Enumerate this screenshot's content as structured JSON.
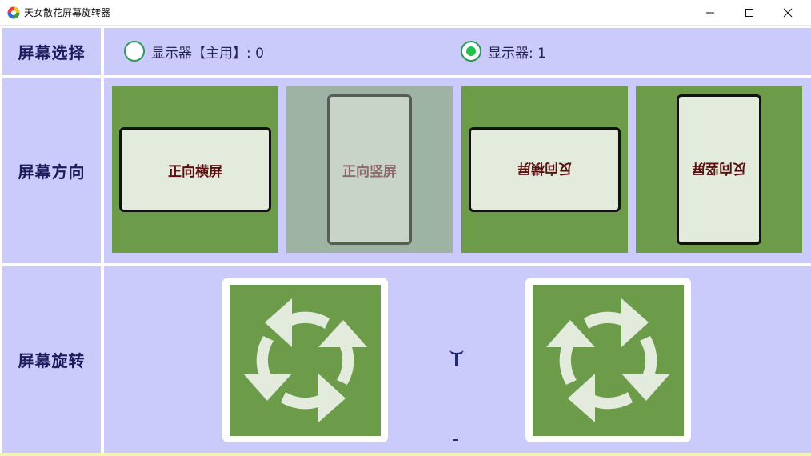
{
  "window": {
    "title": "天女散花屏幕旋转器",
    "icon": "app-logo-icon",
    "controls": [
      "minimize-icon",
      "maximize-icon",
      "close-icon"
    ]
  },
  "rows": {
    "screen_select": {
      "label": "屏幕选择",
      "options": [
        {
          "label": "显示器【主用】: 0",
          "selected": false
        },
        {
          "label": "显示器: 1",
          "selected": true
        }
      ]
    },
    "orientation": {
      "label": "屏幕方向",
      "tiles": [
        {
          "label": "正向横屏",
          "state": "enabled"
        },
        {
          "label": "正向竖屏",
          "state": "disabled"
        },
        {
          "label": "反向横屏",
          "state": "enabled"
        },
        {
          "label": "反向竖屏",
          "state": "enabled"
        }
      ]
    },
    "rotation": {
      "label": "屏幕旋转",
      "buttons": [
        "rotate-counterclockwise-icon",
        "rotate-clockwise-icon"
      ]
    }
  },
  "colors": {
    "panel_bg": "#cbcbfb",
    "tile_green": "#6c9b4a",
    "tile_disabled": "#9eb3a3",
    "card_bg": "#e2ebdc",
    "card_text": "#5c0f0f",
    "label_text": "#1c1c5c",
    "radio_selected": "#22c24b"
  }
}
